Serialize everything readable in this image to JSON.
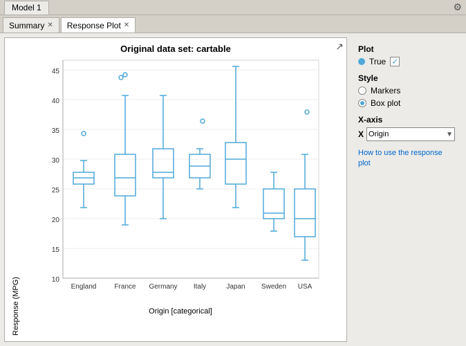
{
  "window": {
    "title_tab": "Model 1",
    "gear_icon": "⚙"
  },
  "tabs": [
    {
      "label": "Summary",
      "active": false,
      "closeable": true
    },
    {
      "label": "Response Plot",
      "active": true,
      "closeable": true
    }
  ],
  "chart": {
    "title": "Original data set: cartable",
    "y_axis_label": "Response (MPG)",
    "x_axis_label": "Origin [categorical]",
    "x_categories": [
      "England",
      "France",
      "Germany",
      "Italy",
      "Japan",
      "Sweden",
      "USA"
    ],
    "y_ticks": [
      "10",
      "15",
      "20",
      "25",
      "30",
      "35",
      "40",
      "45"
    ],
    "restore_icon": "↗"
  },
  "right_panel": {
    "plot_section": {
      "title": "Plot",
      "item_label": "True",
      "checked": true
    },
    "style_section": {
      "title": "Style",
      "options": [
        {
          "label": "Markers",
          "selected": false
        },
        {
          "label": "Box plot",
          "selected": true
        }
      ]
    },
    "xaxis_section": {
      "title": "X-axis",
      "x_label": "X",
      "select_value": "Origin",
      "arrow": "▼"
    },
    "help_link": "How to use the response plot"
  }
}
